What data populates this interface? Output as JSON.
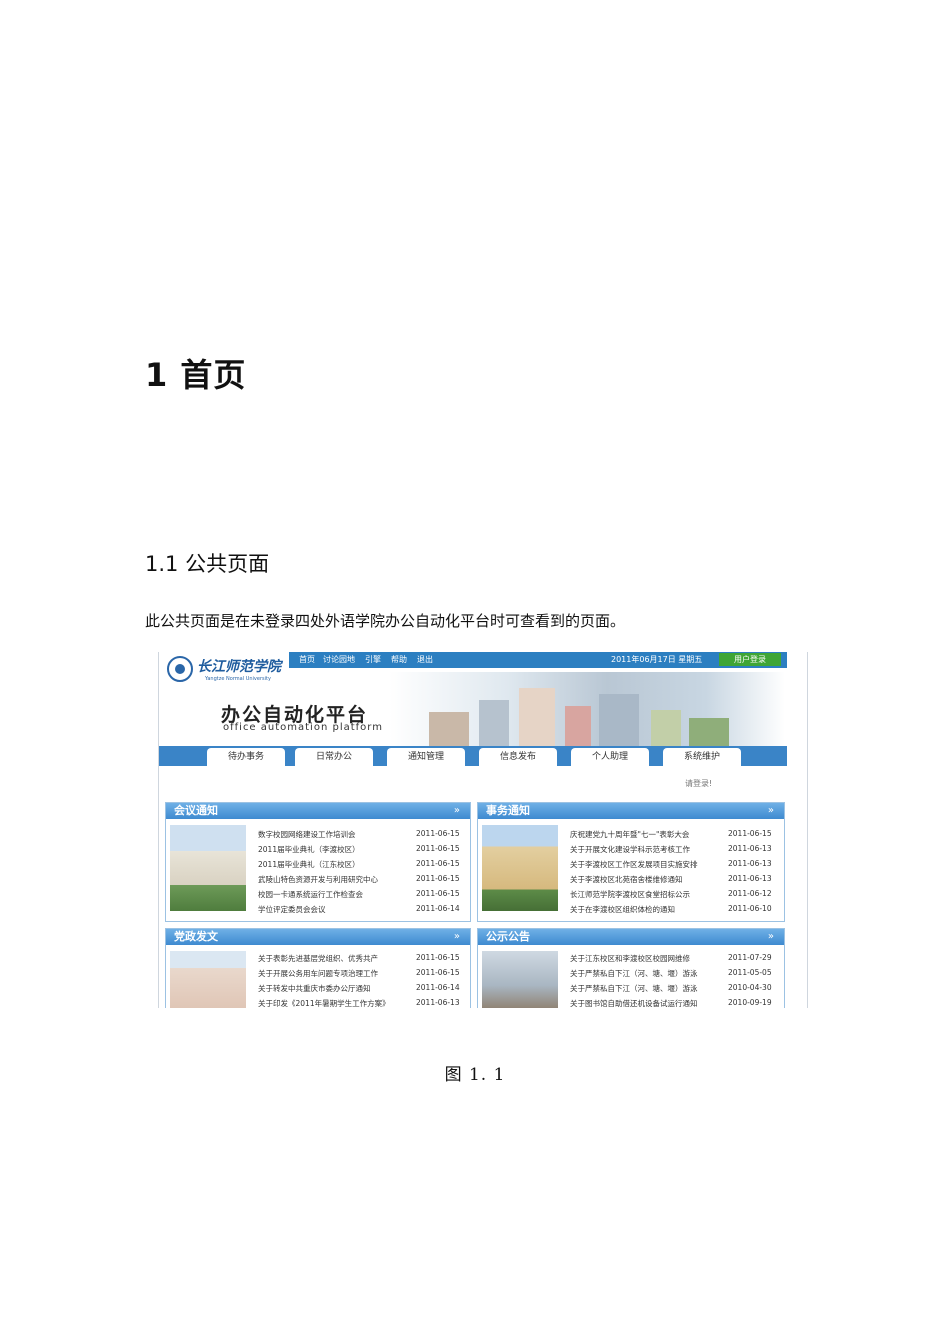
{
  "doc": {
    "heading1": "1 首页",
    "heading2": "1.1 公共页面",
    "paragraph": "此公共页面是在未登录四处外语学院办公自动化平台时可查看到的页面。",
    "caption": "图 1. 1"
  },
  "shot": {
    "top_links": [
      "首页",
      "讨论园地",
      "引擎",
      "帮助",
      "退出"
    ],
    "date": "2011年06月17日 星期五",
    "login_button": "用户登录",
    "school_name": "长江师范学院",
    "school_sub": "Yangtze Normal University",
    "platform_title": "办公自动化平台",
    "platform_sub": "office automation platform",
    "nav": [
      "待办事务",
      "日常办公",
      "通知管理",
      "信息发布",
      "个人助理",
      "系统维护"
    ],
    "login_hint": "请登录!",
    "panels": [
      {
        "title": "会议通知",
        "more": "»",
        "items": [
          {
            "t": "数字校园网络建设工作培训会",
            "d": "2011-06-15"
          },
          {
            "t": "2011届毕业典礼（李渡校区）",
            "d": "2011-06-15"
          },
          {
            "t": "2011届毕业典礼（江东校区）",
            "d": "2011-06-15"
          },
          {
            "t": "武陵山特色资源开发与利用研究中心",
            "d": "2011-06-15"
          },
          {
            "t": "校园一卡通系统运行工作检查会",
            "d": "2011-06-15"
          },
          {
            "t": "学位评定委员会会议",
            "d": "2011-06-14"
          }
        ]
      },
      {
        "title": "事务通知",
        "more": "»",
        "items": [
          {
            "t": "庆祝建党九十周年暨\"七一\"表彰大会",
            "d": "2011-06-15"
          },
          {
            "t": "关于开展文化建设学科示范考核工作",
            "d": "2011-06-13"
          },
          {
            "t": "关于李渡校区工作区发展项目实施安排",
            "d": "2011-06-13"
          },
          {
            "t": "关于李渡校区北苑宿舍楼维修通知",
            "d": "2011-06-13"
          },
          {
            "t": "长江师范学院李渡校区食堂招标公示",
            "d": "2011-06-12"
          },
          {
            "t": "关于在李渡校区组织体检的通知",
            "d": "2011-06-10"
          }
        ]
      },
      {
        "title": "党政发文",
        "more": "»",
        "items": [
          {
            "t": "关于表彰先进基层党组织、优秀共产",
            "d": "2011-06-15"
          },
          {
            "t": "关于开展公务用车问题专项治理工作",
            "d": "2011-06-15"
          },
          {
            "t": "关于转发中共重庆市委办公厅通知",
            "d": "2011-06-14"
          },
          {
            "t": "关于印发《2011年暑期学生工作方案》",
            "d": "2011-06-13"
          }
        ]
      },
      {
        "title": "公示公告",
        "more": "»",
        "items": [
          {
            "t": "关于江东校区和李渡校区校园网维修",
            "d": "2011-07-29"
          },
          {
            "t": "关于严禁私自下江（河、塘、堰）游泳",
            "d": "2011-05-05"
          },
          {
            "t": "关于严禁私自下江（河、塘、堰）游泳",
            "d": "2010-04-30"
          },
          {
            "t": "关于图书馆自助借还机设备试运行通知",
            "d": "2010-09-19"
          }
        ]
      }
    ]
  }
}
